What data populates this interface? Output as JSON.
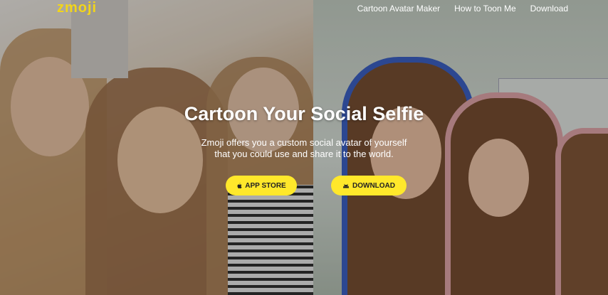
{
  "brand": {
    "logo_text": "zmoji",
    "accent_color": "#f2d51a"
  },
  "nav": {
    "items": [
      {
        "label": "Cartoon Avatar Maker"
      },
      {
        "label": "How to Toon Me"
      },
      {
        "label": "Download"
      }
    ]
  },
  "hero": {
    "title": "Cartoon Your Social Selfie",
    "subtitle_line1": "Zmoji offers you a custom social avatar of yourself",
    "subtitle_line2": "that you could use and share it to the world.",
    "buttons": {
      "app_store": {
        "label": "APP STORE",
        "icon": "apple-icon"
      },
      "download": {
        "label": "DOWNLOAD",
        "icon": "android-icon"
      }
    },
    "button_color": "#ffe82b"
  }
}
